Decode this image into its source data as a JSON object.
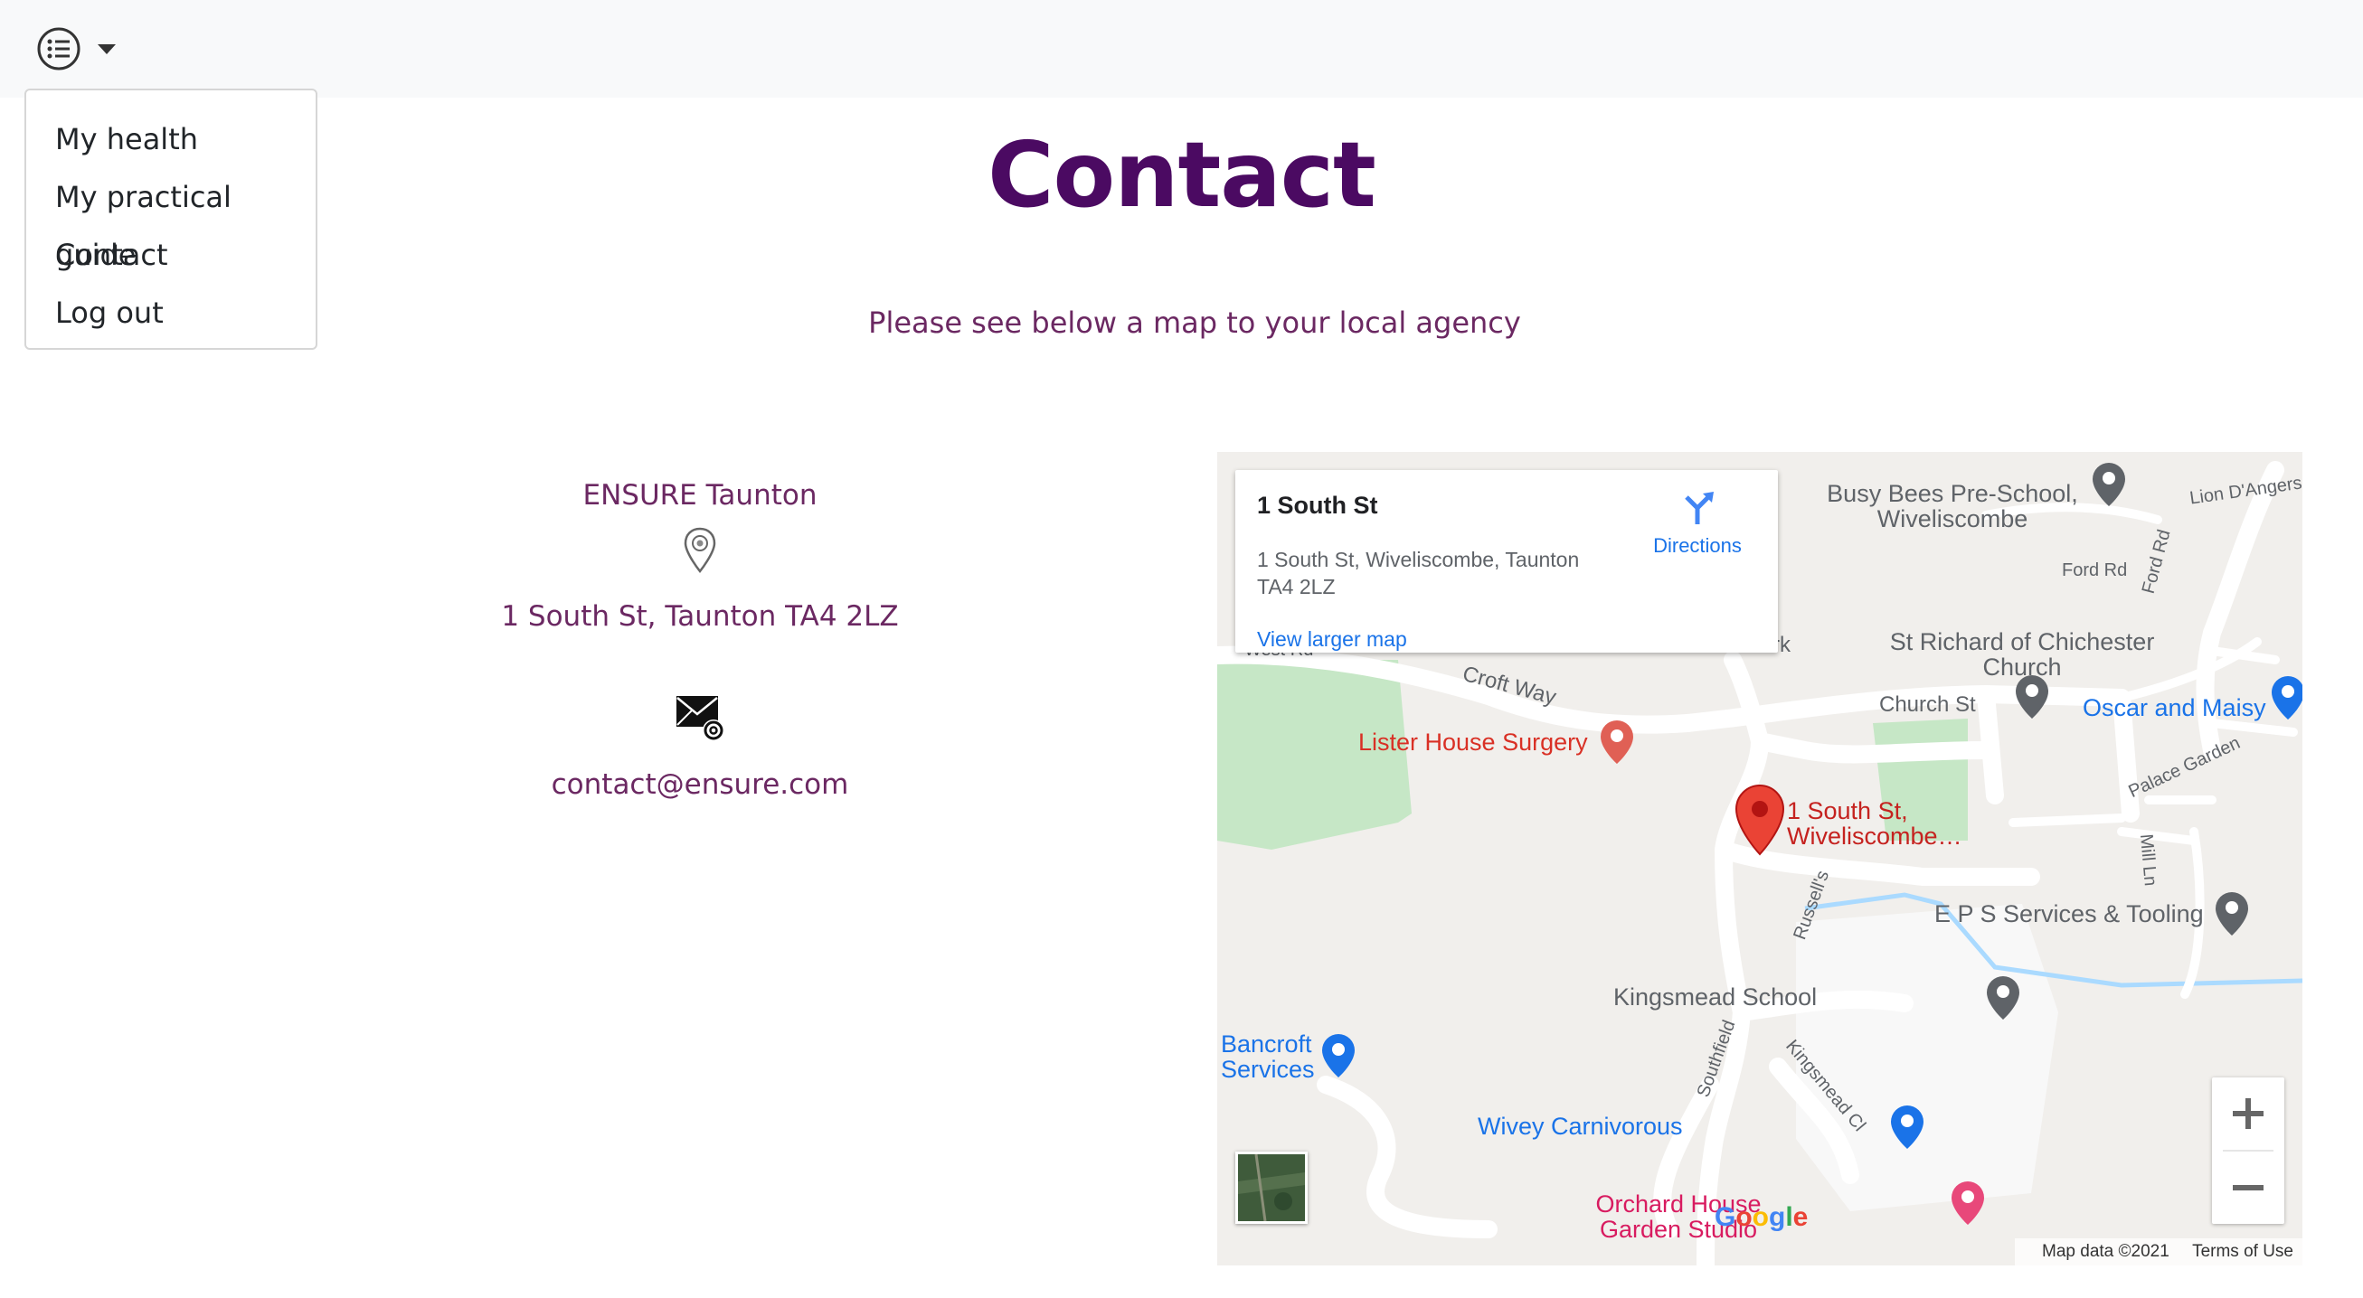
{
  "nav": {
    "menu": [
      "My health",
      "My practical guide",
      "Contact",
      "Log out"
    ]
  },
  "page": {
    "title": "Contact",
    "subtitle": "Please see below a map to your local agency"
  },
  "contact": {
    "agency_name": "ENSURE Taunton",
    "address": "1 South St, Taunton TA4 2LZ",
    "email": "contact@ensure.com"
  },
  "map": {
    "card": {
      "title": "1 South St",
      "address": "1 South St, Wiveliscombe, Taunton TA4 2LZ",
      "directions": "Directions",
      "larger_map": "View larger map"
    },
    "pois": {
      "busy_bees": "Busy Bees Pre-School, Wiveliscombe",
      "st_richard": "St Richard of Chichester Church",
      "oscar": "Oscar and Maisy",
      "lister": "Lister House Surgery",
      "marker": "1 South St, Wiveliscombe…",
      "eps": "E P S Services & Tooling",
      "kingsmead": "Kingsmead School",
      "bancroft": "Bancroft Services",
      "wivey": "Wivey Carnivorous",
      "orchard": "Orchard House Garden Studio"
    },
    "streets": {
      "lion": "Lion D'Angers",
      "ford_rd": "Ford Rd",
      "ford_rd_v": "Ford Rd",
      "croft": "Croft Way",
      "church": "Church St",
      "palace": "Palace Garden",
      "mill": "Mill Ln",
      "russells": "Russell's",
      "southfield": "Southfield",
      "kingsmead_cl": "Kingsmead Cl",
      "west_rd": "West Rd",
      "park": "rk"
    },
    "footer": {
      "data": "Map data ©2021",
      "terms": "Terms of Use"
    },
    "logo": "Google",
    "colors": {
      "poi_red": "#d93025",
      "poi_blue": "#1a73e8",
      "poi_gray": "#5f6368",
      "green_area": "#c6e7c6",
      "water": "#aadaff",
      "marker_text": "#c5221f"
    }
  }
}
